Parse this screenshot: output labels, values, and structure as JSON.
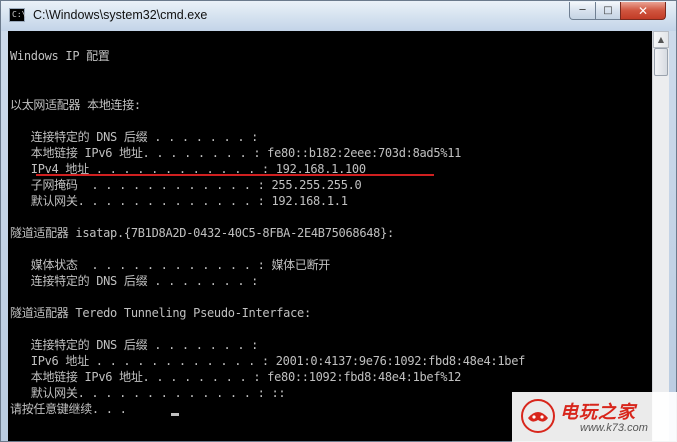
{
  "window": {
    "title": "C:\\Windows\\system32\\cmd.exe",
    "icon_label": "C:\\",
    "minimize_glyph": "─",
    "maximize_glyph": "□",
    "close_glyph": "✕"
  },
  "console": {
    "lines": [
      "",
      "Windows IP 配置",
      "",
      "",
      "以太网适配器 本地连接:",
      "",
      "   连接特定的 DNS 后缀 . . . . . . . :",
      "   本地链接 IPv6 地址. . . . . . . . : fe80::b182:2eee:703d:8ad5%11",
      "   IPv4 地址 . . . . . . . . . . . . : 192.168.1.100",
      "   子网掩码  . . . . . . . . . . . . : 255.255.255.0",
      "   默认网关. . . . . . . . . . . . . : 192.168.1.1",
      "",
      "隧道适配器 isatap.{7B1D8A2D-0432-40C5-8FBA-2E4B75068648}:",
      "",
      "   媒体状态  . . . . . . . . . . . . : 媒体已断开",
      "   连接特定的 DNS 后缀 . . . . . . . :",
      "",
      "隧道适配器 Teredo Tunneling Pseudo-Interface:",
      "",
      "   连接特定的 DNS 后缀 . . . . . . . :",
      "   IPv6 地址 . . . . . . . . . . . . : 2001:0:4137:9e76:1092:fbd8:48e4:1bef",
      "   本地链接 IPv6 地址. . . . . . . . : fe80::1092:fbd8:48e4:1bef%12",
      "   默认网关. . . . . . . . . . . . . : ::",
      "请按任意键继续. . ."
    ]
  },
  "scrollbar": {
    "up_glyph": "▲"
  },
  "watermark": {
    "text": "电玩之家",
    "url": "www.k73.com"
  },
  "colors": {
    "console_bg": "#000000",
    "console_fg": "#c0c0c0",
    "highlight_underline": "#d02020",
    "watermark_red": "#d8261c"
  }
}
